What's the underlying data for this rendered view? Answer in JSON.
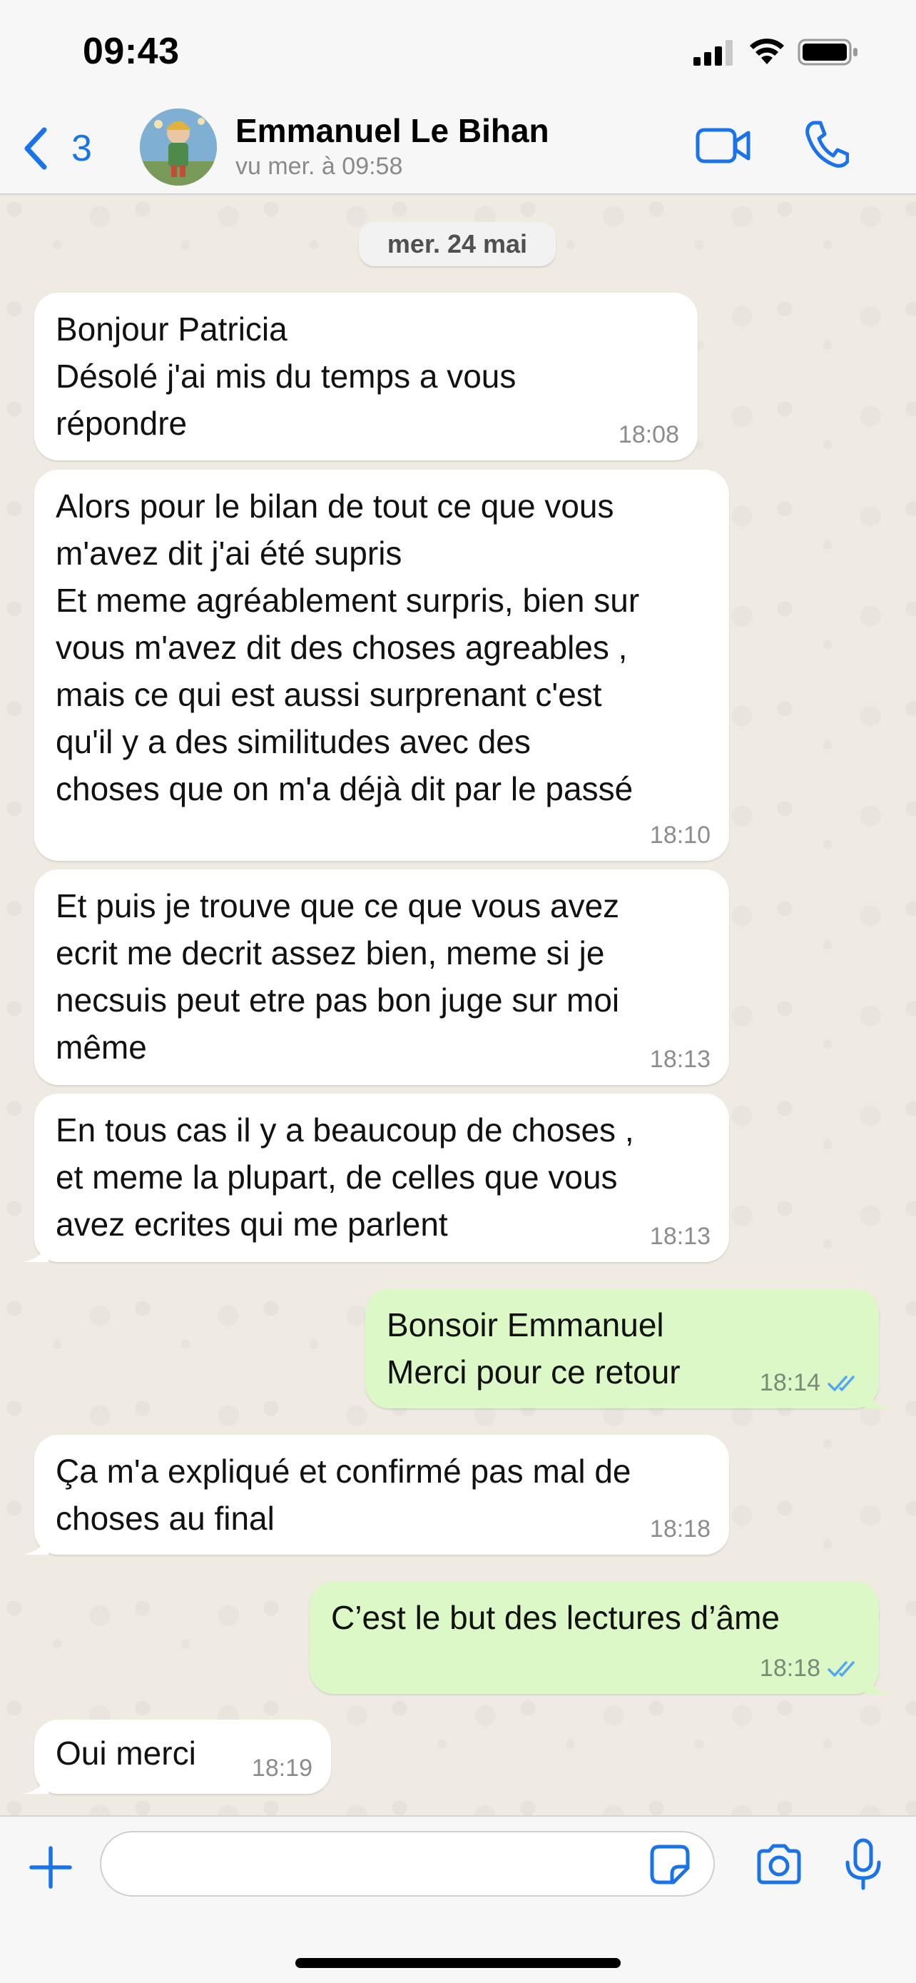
{
  "status_bar": {
    "time": "09:43"
  },
  "header": {
    "back_count": "3",
    "contact_name": "Emmanuel Le Bihan",
    "contact_status": "vu mer. à 09:58"
  },
  "chat": {
    "date_chip": "mer. 24 mai",
    "messages": [
      {
        "direction": "in",
        "text": "Bonjour Patricia\nDésolé j'ai mis du temps a vous\nrépondre",
        "time": "18:08"
      },
      {
        "direction": "in",
        "text": "Alors pour le bilan de tout ce que vous\nm'avez dit j'ai été supris\nEt meme agréablement surpris, bien sur\nvous m'avez dit des choses agreables ,\nmais ce qui est aussi surprenant c'est\nqu'il y a des similitudes avec des\nchoses que on m'a déjà dit par le passé",
        "time": "18:10"
      },
      {
        "direction": "in",
        "text": "Et puis je trouve que ce que vous avez\necrit me decrit assez bien, meme si je\nnecsuis peut etre pas bon juge sur moi\nmême",
        "time": "18:13"
      },
      {
        "direction": "in",
        "text": "En tous cas il y a beaucoup de choses ,\net meme la plupart, de celles que vous\navez ecrites qui me parlent",
        "time": "18:13"
      },
      {
        "direction": "out",
        "text": "Bonsoir Emmanuel\nMerci pour ce retour",
        "time": "18:14",
        "read": true
      },
      {
        "direction": "in",
        "text": "Ça m'a expliqué et confirmé pas mal de\nchoses au final",
        "time": "18:18"
      },
      {
        "direction": "out",
        "text": "C’est le but des lectures d’âme",
        "time": "18:18",
        "read": true
      },
      {
        "direction": "in",
        "text": "Oui merci",
        "time": "18:19"
      }
    ]
  },
  "composer": {
    "placeholder": ""
  },
  "colors": {
    "accent": "#1a73e8",
    "incoming_bubble": "#ffffff",
    "outgoing_bubble": "#dcf8c6",
    "chat_background": "#efeae2",
    "read_ticks": "#53a6f4"
  }
}
